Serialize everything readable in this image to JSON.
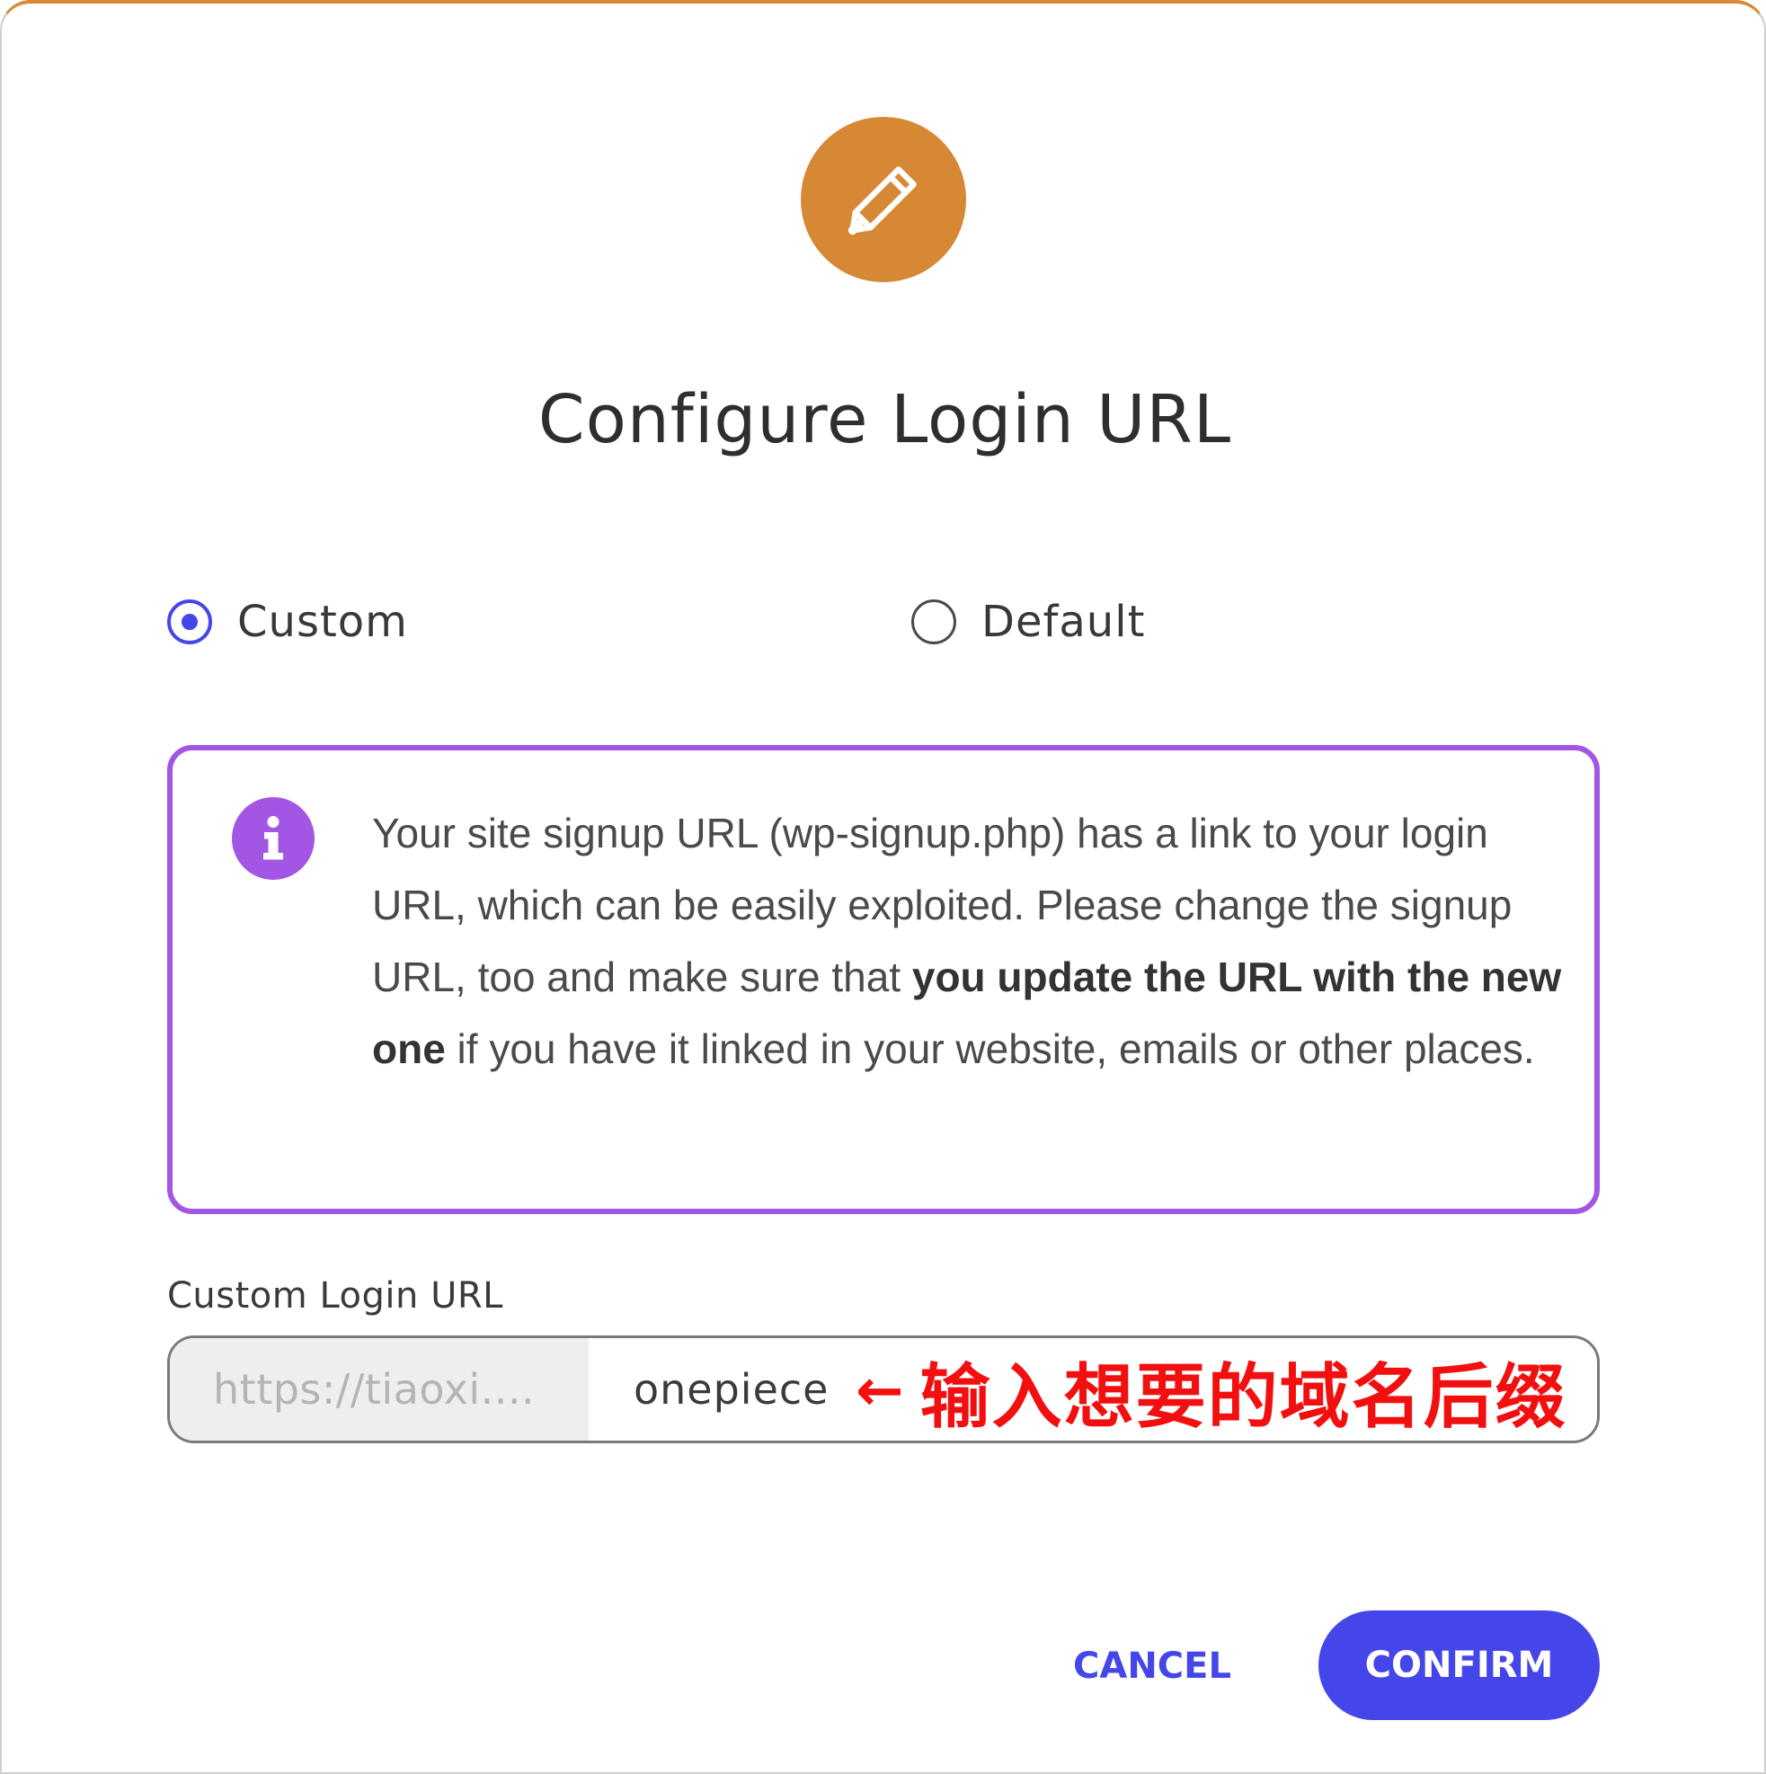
{
  "dialog": {
    "title": "Configure Login URL",
    "hero_icon": "pencil-icon",
    "hero_color": "#d68835"
  },
  "options": {
    "custom_label": "Custom",
    "default_label": "Default",
    "selected": "Custom"
  },
  "notice": {
    "icon": "info-icon",
    "color": "#a356e3",
    "text_part1": "Your site signup URL (wp-signup.php) has a link to your login URL, which can be easily exploited. Please change the signup URL, too and make sure that ",
    "text_bold": "you update the URL with the new one",
    "text_part2": " if you have it linked in your website, emails or other places."
  },
  "url_field": {
    "label": "Custom Login URL",
    "prefix": "https://tiaoxi....",
    "value": "onepiece"
  },
  "annotation": {
    "arrow": "←",
    "text": "输入想要的域名后缀",
    "color": "#f20f0f"
  },
  "actions": {
    "cancel_label": "CANCEL",
    "confirm_label": "CONFIRM",
    "accent": "#4546e9"
  }
}
